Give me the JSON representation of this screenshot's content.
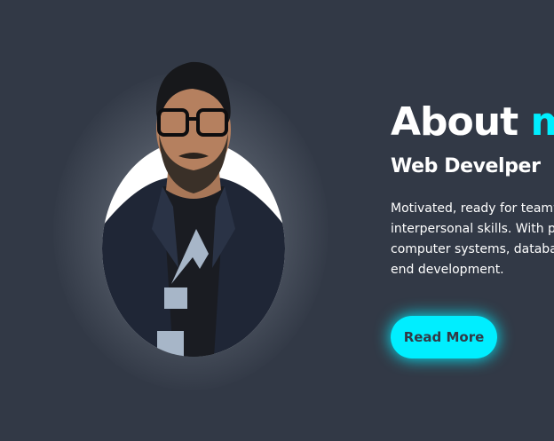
{
  "about": {
    "heading_main": "About",
    "heading_accent": "me",
    "subtitle": "Web Develper",
    "bio_lines": [
      "Motivated, ready for teamwor",
      "interpersonal skills. With previ",
      "computer systems, database",
      "end development."
    ],
    "read_more_label": "Read More"
  },
  "colors": {
    "background": "#323946",
    "accent": "#00eeff",
    "text": "#ffffff",
    "glow": "#c0c4cc"
  },
  "portrait": {
    "icon": "profile-photo",
    "shirt_logo_icon": "triangle-logo"
  }
}
